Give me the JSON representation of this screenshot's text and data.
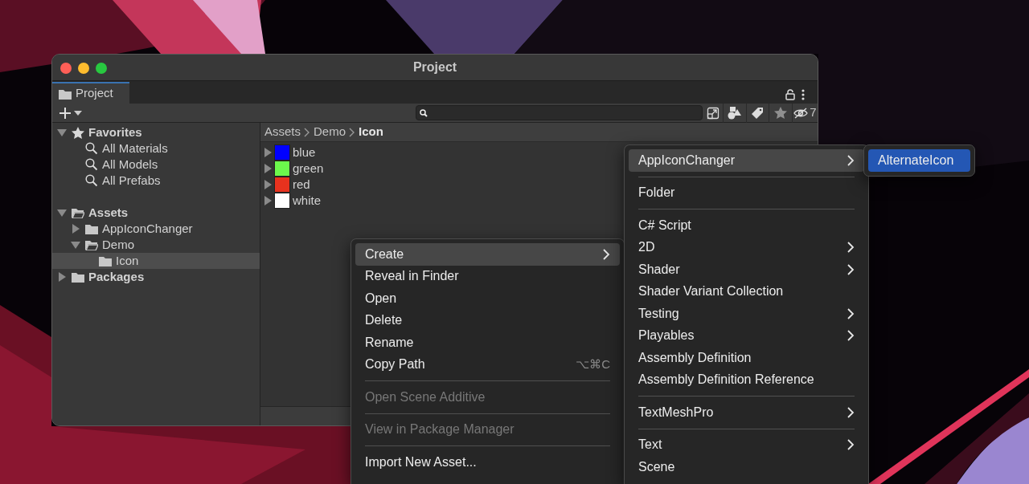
{
  "window": {
    "title": "Project"
  },
  "tabs": [
    {
      "label": "Project",
      "selected": true
    }
  ],
  "toolbar": {
    "hidden_count": "7"
  },
  "tree": [
    {
      "label": "Favorites",
      "kind": "favorites",
      "expanded": true,
      "selected": false,
      "children": [
        {
          "label": "All Materials",
          "kind": "search",
          "selected": false
        },
        {
          "label": "All Models",
          "kind": "search",
          "selected": false
        },
        {
          "label": "All Prefabs",
          "kind": "search",
          "selected": false
        }
      ]
    },
    {
      "label": "Assets",
      "kind": "folder",
      "expanded": true,
      "selected": false,
      "children": [
        {
          "label": "AppIconChanger",
          "kind": "folder",
          "expanded": false,
          "selected": false
        },
        {
          "label": "Demo",
          "kind": "folder",
          "expanded": true,
          "selected": false,
          "children": [
            {
              "label": "Icon",
              "kind": "folder",
              "selected": true
            }
          ]
        }
      ]
    },
    {
      "label": "Packages",
      "kind": "folder",
      "expanded": false,
      "selected": false
    }
  ],
  "breadcrumb": [
    "Assets",
    "Demo",
    "Icon"
  ],
  "assets": [
    {
      "label": "blue",
      "color": "#0000ff"
    },
    {
      "label": "green",
      "color": "#6cf84c"
    },
    {
      "label": "red",
      "color": "#e8321e"
    },
    {
      "label": "white",
      "color": "#ffffff"
    }
  ],
  "context_menu": [
    {
      "kind": "item",
      "label": "Create",
      "submenu": true,
      "disabled": false,
      "selected": true
    },
    {
      "kind": "item",
      "label": "Reveal in Finder",
      "submenu": false,
      "disabled": false,
      "selected": false
    },
    {
      "kind": "item",
      "label": "Open",
      "submenu": false,
      "disabled": false,
      "selected": false
    },
    {
      "kind": "item",
      "label": "Delete",
      "submenu": false,
      "disabled": false,
      "selected": false
    },
    {
      "kind": "item",
      "label": "Rename",
      "submenu": false,
      "disabled": false,
      "selected": false
    },
    {
      "kind": "item",
      "label": "Copy Path",
      "shortcut": "⌥⌘C",
      "submenu": false,
      "disabled": false,
      "selected": false
    },
    {
      "kind": "separator"
    },
    {
      "kind": "item",
      "label": "Open Scene Additive",
      "submenu": false,
      "disabled": true,
      "selected": false
    },
    {
      "kind": "separator"
    },
    {
      "kind": "item",
      "label": "View in Package Manager",
      "submenu": false,
      "disabled": true,
      "selected": false
    },
    {
      "kind": "separator"
    },
    {
      "kind": "item",
      "label": "Import New Asset...",
      "submenu": false,
      "disabled": false,
      "selected": false
    }
  ],
  "create_menu": [
    {
      "kind": "item",
      "label": "AppIconChanger",
      "submenu": true,
      "selected": true
    },
    {
      "kind": "separator"
    },
    {
      "kind": "item",
      "label": "Folder",
      "submenu": false,
      "selected": false
    },
    {
      "kind": "separator"
    },
    {
      "kind": "item",
      "label": "C# Script",
      "submenu": false,
      "selected": false
    },
    {
      "kind": "item",
      "label": "2D",
      "submenu": true,
      "selected": false
    },
    {
      "kind": "item",
      "label": "Shader",
      "submenu": true,
      "selected": false
    },
    {
      "kind": "item",
      "label": "Shader Variant Collection",
      "submenu": false,
      "selected": false
    },
    {
      "kind": "item",
      "label": "Testing",
      "submenu": true,
      "selected": false
    },
    {
      "kind": "item",
      "label": "Playables",
      "submenu": true,
      "selected": false
    },
    {
      "kind": "item",
      "label": "Assembly Definition",
      "submenu": false,
      "selected": false
    },
    {
      "kind": "item",
      "label": "Assembly Definition Reference",
      "submenu": false,
      "selected": false
    },
    {
      "kind": "separator"
    },
    {
      "kind": "item",
      "label": "TextMeshPro",
      "submenu": true,
      "selected": false
    },
    {
      "kind": "separator"
    },
    {
      "kind": "item",
      "label": "Text",
      "submenu": true,
      "selected": false
    },
    {
      "kind": "item",
      "label": "Scene",
      "submenu": false,
      "selected": false
    }
  ],
  "appiconchanger_menu": [
    {
      "label": "AlternateIcon",
      "selected": true
    }
  ]
}
